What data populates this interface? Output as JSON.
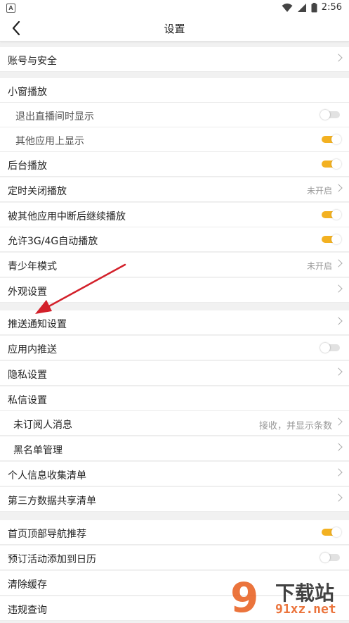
{
  "status": {
    "time": "2:56",
    "app_icon_letter": "A"
  },
  "header": {
    "title": "设置"
  },
  "rows": {
    "account": {
      "label": "账号与安全"
    },
    "mini_window": {
      "label": "小窗播放"
    },
    "exit_live": {
      "label": "退出直播间时显示",
      "toggle": false
    },
    "other_apps": {
      "label": "其他应用上显示",
      "toggle": true
    },
    "background_play": {
      "label": "后台播放",
      "toggle": true
    },
    "timer_close": {
      "label": "定时关闭播放",
      "value": "未开启"
    },
    "resume_after_interrupt": {
      "label": "被其他应用中断后继续播放",
      "toggle": true
    },
    "allow_cellular": {
      "label": "允许3G/4G自动播放",
      "toggle": true
    },
    "teen_mode": {
      "label": "青少年模式",
      "value": "未开启"
    },
    "appearance": {
      "label": "外观设置"
    },
    "push_settings": {
      "label": "推送通知设置"
    },
    "in_app_push": {
      "label": "应用内推送",
      "toggle": false
    },
    "privacy": {
      "label": "隐私设置"
    },
    "message_settings": {
      "label": "私信设置"
    },
    "unsubscribed_messages": {
      "label": "未订阅人消息",
      "value": "接收，并显示条数"
    },
    "blacklist": {
      "label": "黑名单管理"
    },
    "personal_info": {
      "label": "个人信息收集清单"
    },
    "third_party": {
      "label": "第三方数据共享清单"
    },
    "home_nav": {
      "label": "首页顶部导航推荐",
      "toggle": true
    },
    "calendar": {
      "label": "预订活动添加到日历",
      "toggle": false
    },
    "clear_cache": {
      "label": "清除缓存"
    },
    "violation_query": {
      "label": "违规查询"
    }
  },
  "watermark": {
    "logo": "9",
    "text": "下载站",
    "site": "91xz.net"
  },
  "colors": {
    "accent": "#f3b121",
    "annotation_arrow": "#d3202a"
  }
}
